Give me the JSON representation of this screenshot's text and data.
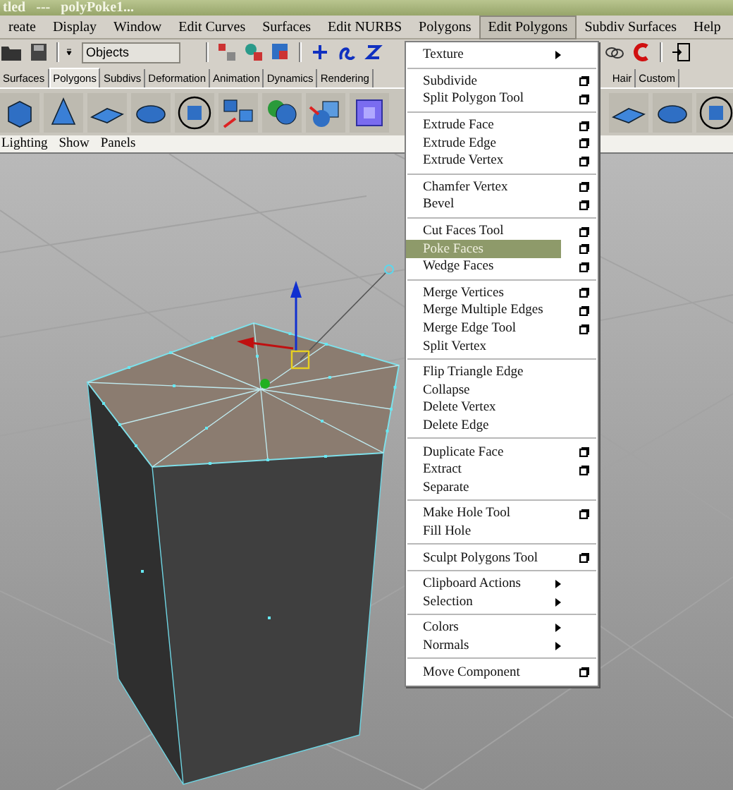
{
  "window": {
    "title": "tled   ---   polyPoke1..."
  },
  "menu_bar": [
    {
      "label": "reate",
      "selected": false
    },
    {
      "label": "Display",
      "selected": false
    },
    {
      "label": "Window",
      "selected": false
    },
    {
      "label": "Edit Curves",
      "selected": false
    },
    {
      "label": "Surfaces",
      "selected": false
    },
    {
      "label": "Edit NURBS",
      "selected": false
    },
    {
      "label": "Polygons",
      "selected": false
    },
    {
      "label": "Edit Polygons",
      "selected": true
    },
    {
      "label": "Subdiv Surfaces",
      "selected": false
    },
    {
      "label": "Help",
      "selected": false
    }
  ],
  "toolbar": {
    "select_mode": "Objects"
  },
  "shelf_tabs": [
    {
      "label": "Surfaces",
      "selected": false
    },
    {
      "label": "Polygons",
      "selected": true
    },
    {
      "label": "Subdivs",
      "selected": false
    },
    {
      "label": "Deformation",
      "selected": false
    },
    {
      "label": "Animation",
      "selected": false
    },
    {
      "label": "Dynamics",
      "selected": false
    },
    {
      "label": "Rendering",
      "selected": false
    },
    {
      "label": "Hair",
      "selected": false
    },
    {
      "label": "Custom",
      "selected": false
    }
  ],
  "panel_menu": [
    "Lighting",
    "Show",
    "Panels"
  ],
  "dropdown": {
    "groups": [
      [
        {
          "label": "Texture",
          "kind": "submenu",
          "selected": false
        }
      ],
      [
        {
          "label": "Subdivide",
          "kind": "option",
          "selected": false
        },
        {
          "label": "Split Polygon Tool",
          "kind": "option",
          "selected": false
        }
      ],
      [
        {
          "label": "Extrude Face",
          "kind": "option",
          "selected": false
        },
        {
          "label": "Extrude Edge",
          "kind": "option",
          "selected": false
        },
        {
          "label": "Extrude Vertex",
          "kind": "option",
          "selected": false
        }
      ],
      [
        {
          "label": "Chamfer Vertex",
          "kind": "option",
          "selected": false
        },
        {
          "label": "Bevel",
          "kind": "option",
          "selected": false
        }
      ],
      [
        {
          "label": "Cut Faces Tool",
          "kind": "option",
          "selected": false
        },
        {
          "label": "Poke Faces",
          "kind": "option",
          "selected": true
        },
        {
          "label": "Wedge Faces",
          "kind": "option",
          "selected": false
        }
      ],
      [
        {
          "label": "Merge Vertices",
          "kind": "option",
          "selected": false
        },
        {
          "label": "Merge Multiple Edges",
          "kind": "option",
          "selected": false
        },
        {
          "label": "Merge Edge Tool",
          "kind": "option",
          "selected": false
        },
        {
          "label": "Split Vertex",
          "kind": "plain",
          "selected": false
        }
      ],
      [
        {
          "label": "Flip Triangle Edge",
          "kind": "plain",
          "selected": false
        },
        {
          "label": "Collapse",
          "kind": "plain",
          "selected": false
        },
        {
          "label": "Delete Vertex",
          "kind": "plain",
          "selected": false
        },
        {
          "label": "Delete Edge",
          "kind": "plain",
          "selected": false
        }
      ],
      [
        {
          "label": "Duplicate Face",
          "kind": "option",
          "selected": false
        },
        {
          "label": "Extract",
          "kind": "option",
          "selected": false
        },
        {
          "label": "Separate",
          "kind": "plain",
          "selected": false
        }
      ],
      [
        {
          "label": "Make Hole Tool",
          "kind": "option",
          "selected": false
        },
        {
          "label": "Fill Hole",
          "kind": "plain",
          "selected": false
        }
      ],
      [
        {
          "label": "Sculpt Polygons Tool",
          "kind": "option",
          "selected": false
        }
      ],
      [
        {
          "label": "Clipboard Actions",
          "kind": "submenu",
          "selected": false
        },
        {
          "label": "Selection",
          "kind": "submenu",
          "selected": false
        }
      ],
      [
        {
          "label": "Colors",
          "kind": "submenu",
          "selected": false
        },
        {
          "label": "Normals",
          "kind": "submenu",
          "selected": false
        }
      ],
      [
        {
          "label": "Move Component",
          "kind": "option",
          "selected": false
        }
      ]
    ]
  }
}
